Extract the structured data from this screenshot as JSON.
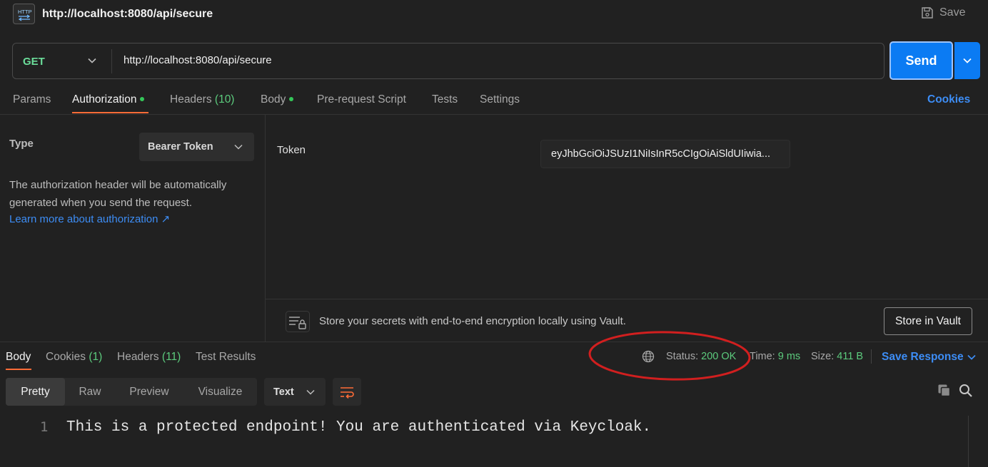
{
  "title_bar": {
    "badge": "HTTP",
    "request_name": "http://localhost:8080/api/secure",
    "save_label": "Save"
  },
  "request": {
    "method": "GET",
    "url": "http://localhost:8080/api/secure",
    "send_label": "Send"
  },
  "request_tabs": {
    "params": "Params",
    "authorization": "Authorization",
    "headers": "Headers",
    "headers_count": "(10)",
    "body": "Body",
    "pre_request_script": "Pre-request Script",
    "tests": "Tests",
    "settings": "Settings",
    "cookies": "Cookies"
  },
  "auth": {
    "type_label": "Type",
    "type_value": "Bearer Token",
    "description": "The authorization header will be automatically generated when you send the request.",
    "learn_more": "Learn more about authorization ↗",
    "token_label": "Token",
    "token_value": "eyJhbGciOiJSUzI1NiIsInR5cCIgOiAiSldUIiwia..."
  },
  "vault": {
    "message": "Store your secrets with end-to-end encryption locally using Vault.",
    "button": "Store in Vault"
  },
  "response_tabs": {
    "body": "Body",
    "cookies": "Cookies",
    "cookies_count": "(1)",
    "headers": "Headers",
    "headers_count": "(11)",
    "test_results": "Test Results"
  },
  "response_meta": {
    "status_label": "Status:",
    "status_value": "200 OK",
    "time_label": "Time:",
    "time_value": "9 ms",
    "size_label": "Size:",
    "size_value": "411 B",
    "save_response": "Save Response"
  },
  "view_modes": [
    "Pretty",
    "Raw",
    "Preview",
    "Visualize"
  ],
  "format": "Text",
  "body_lines": [
    {
      "number": "1",
      "text": "This is a protected endpoint! You are authenticated via Keycloak."
    }
  ],
  "colors": {
    "accent_orange": "#ff6c37",
    "send_blue": "#0b7bf3",
    "link_blue": "#3d8df5",
    "success_green": "#5ccb7d",
    "method_green": "#6bdd9a",
    "annotation_red": "#d11f1f"
  }
}
